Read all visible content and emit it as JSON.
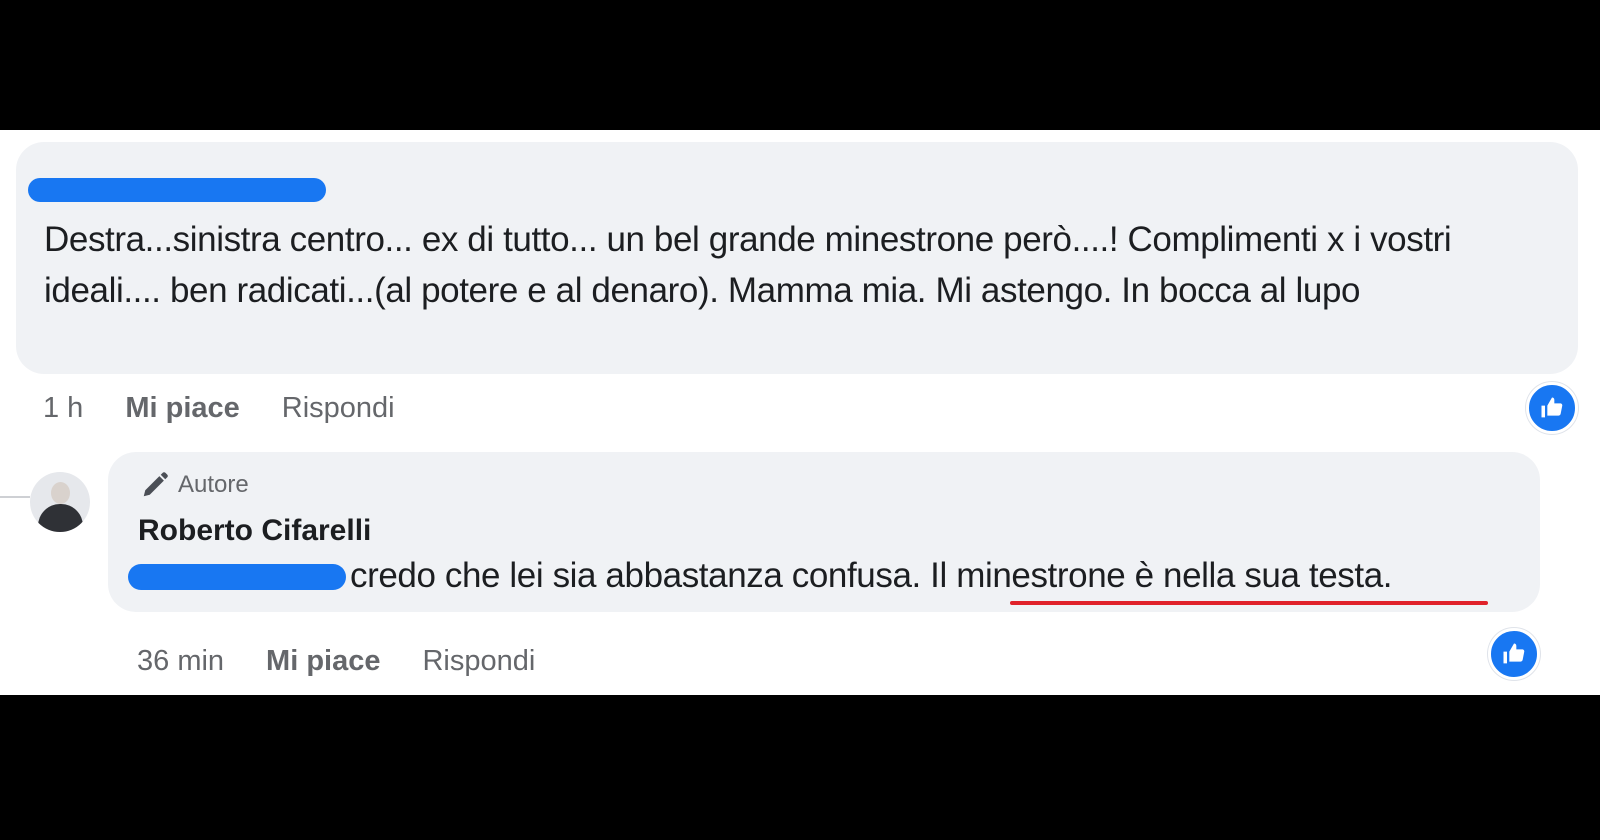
{
  "comments": [
    {
      "author_redacted": true,
      "text": "Destra...sinistra centro... ex di tutto... un bel grande minestrone però....! Complimenti x i vostri ideali.... ben radicati...(al potere e al denaro). Mamma mia. Mi astengo. In bocca al lupo",
      "time": "1 h",
      "like_label": "Mi piace",
      "reply_label": "Rispondi",
      "reaction_icon": "thumbs-up-icon"
    }
  ],
  "reply": {
    "badge_icon": "pencil-icon",
    "badge_label": "Autore",
    "author": "Roberto Cifarelli",
    "mention_redacted": true,
    "text": "credo che lei sia abbastanza confusa. Il minestrone è nella sua testa.",
    "time": "36 min",
    "like_label": "Mi piace",
    "reply_label": "Rispondi",
    "reaction_icon": "thumbs-up-icon"
  },
  "colors": {
    "accent": "#1877f2",
    "bubble": "#f0f2f5",
    "annotation_underline": "#e0222a"
  }
}
